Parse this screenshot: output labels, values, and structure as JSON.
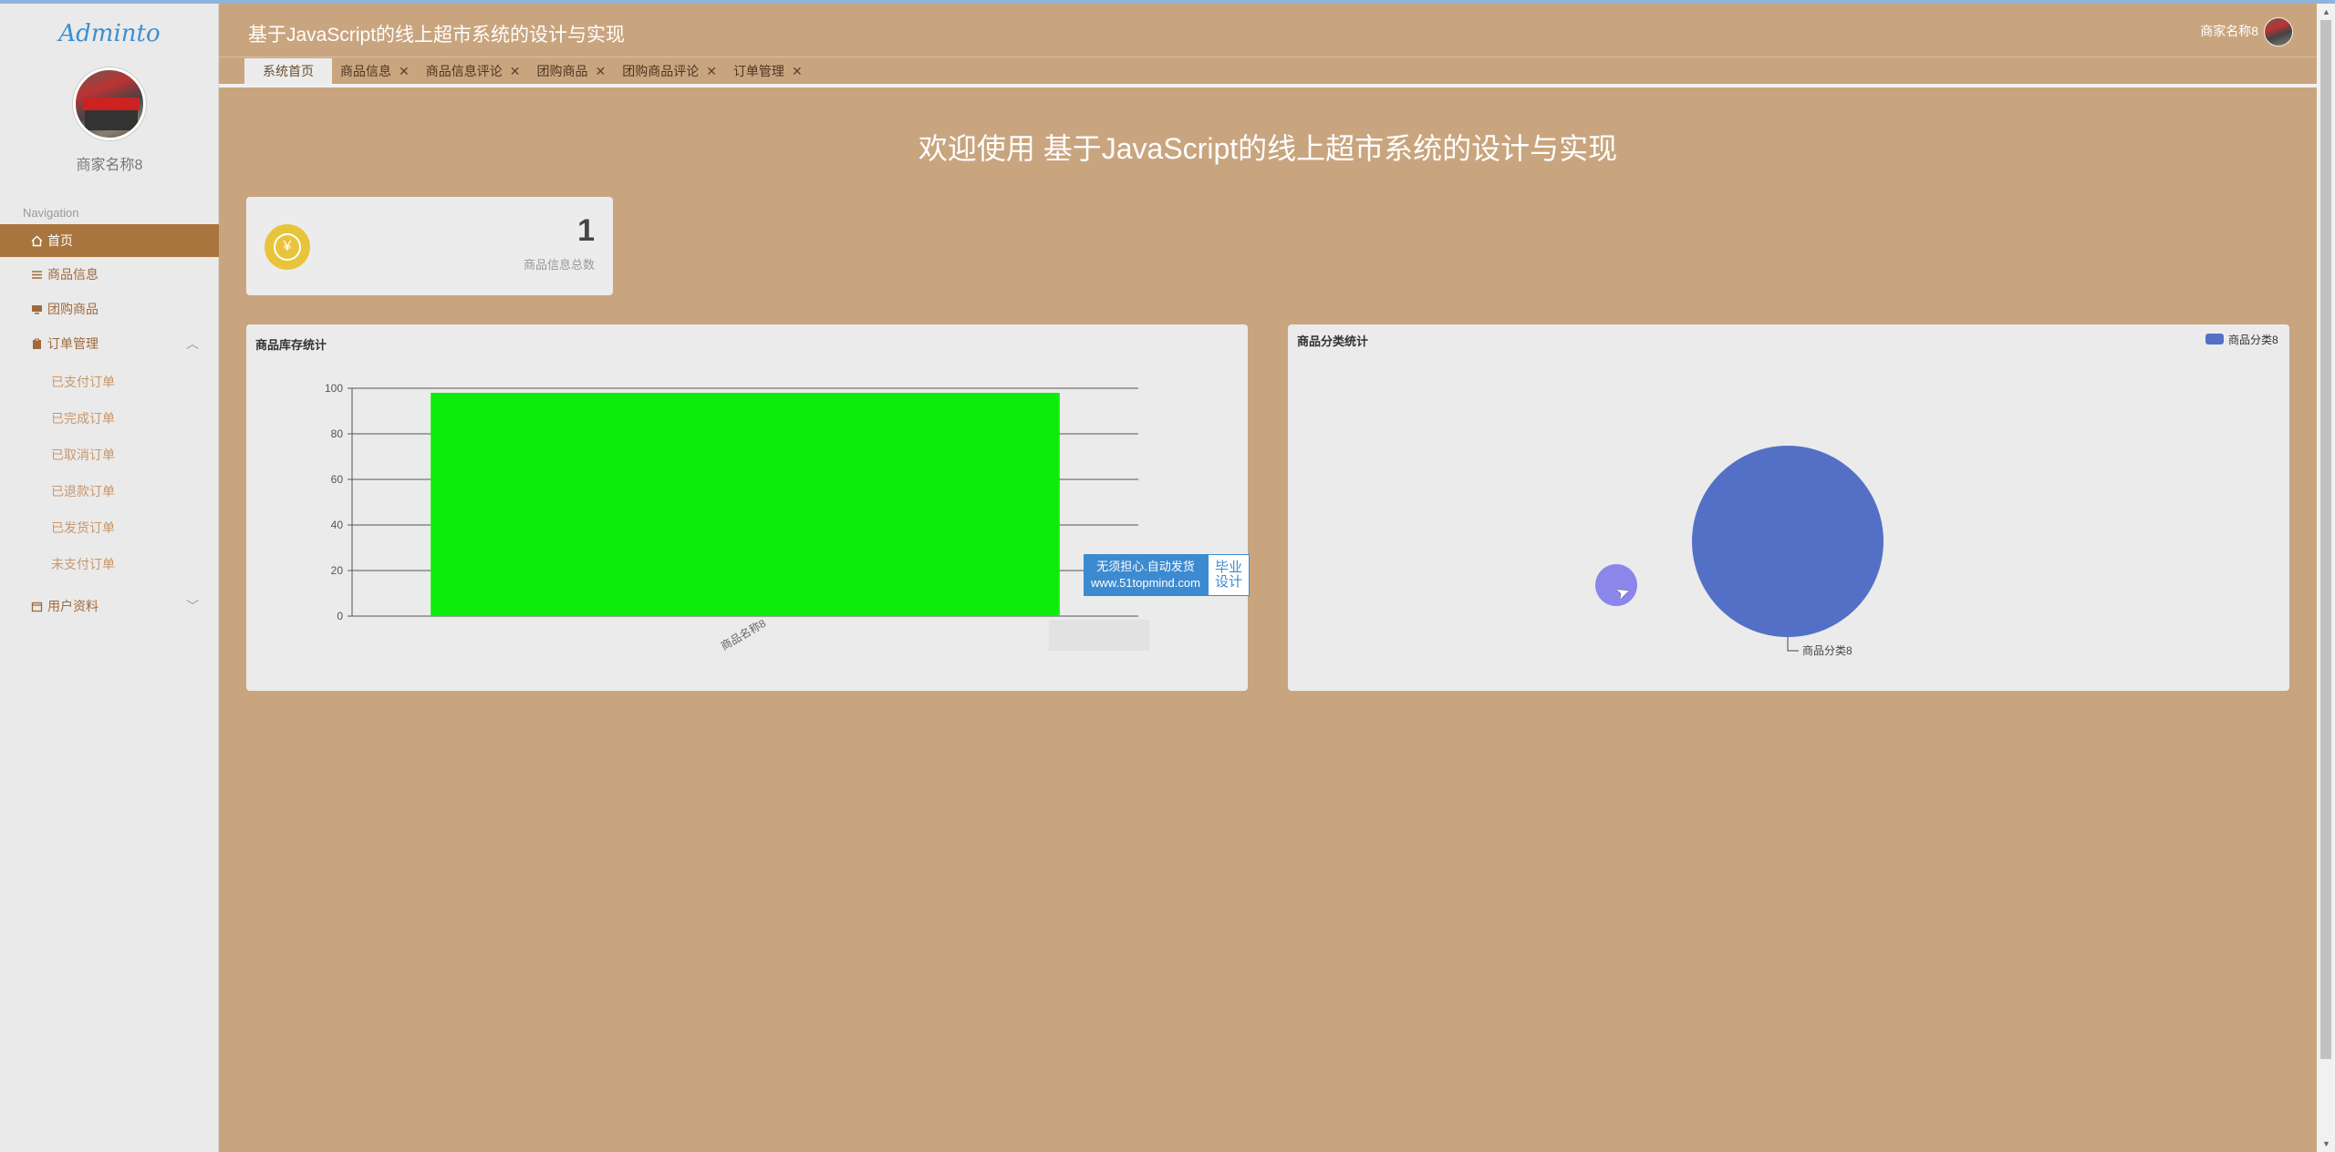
{
  "app": {
    "logo": "Adminto",
    "title": "基于JavaScript的线上超市系统的设计与实现",
    "user_name": "商家名称8"
  },
  "sidebar": {
    "user_name": "商家名称8",
    "nav_heading": "Navigation",
    "items": [
      {
        "label": "首页",
        "icon": "home-icon"
      },
      {
        "label": "商品信息",
        "icon": "list-icon"
      },
      {
        "label": "团购商品",
        "icon": "monitor-icon"
      },
      {
        "label": "订单管理",
        "icon": "clipboard-icon"
      },
      {
        "label": "用户资料",
        "icon": "calendar-icon"
      }
    ],
    "order_subitems": [
      "已支付订单",
      "已完成订单",
      "已取消订单",
      "已退款订单",
      "已发货订单",
      "未支付订单"
    ]
  },
  "tabs": [
    {
      "label": "系统首页",
      "active": true
    },
    {
      "label": "商品信息"
    },
    {
      "label": "商品信息评论"
    },
    {
      "label": "团购商品"
    },
    {
      "label": "团购商品评论"
    },
    {
      "label": "订单管理"
    }
  ],
  "welcome": "欢迎使用 基于JavaScript的线上超市系统的设计与实现",
  "stat": {
    "value": "1",
    "label": "商品信息总数",
    "icon_glyph": "¥"
  },
  "watermark": {
    "line1": "无须担心.自动发货",
    "line2": "www.51topmind.com",
    "side1": "毕业",
    "side2": "设计"
  },
  "colors": {
    "accent": "#a8753f",
    "background": "#c9a57f",
    "bar": "#0ced0c",
    "pie": "#5470c6"
  },
  "chart_data": [
    {
      "type": "bar",
      "title": "商品库存统计",
      "categories": [
        "商品名称8"
      ],
      "values": [
        98
      ],
      "ylim": [
        0,
        100
      ],
      "yticks": [
        0,
        20,
        40,
        60,
        80,
        100
      ],
      "grid": true
    },
    {
      "type": "pie",
      "title": "商品分类统计",
      "legend_position": "top-right",
      "slices": [
        {
          "label": "商品分类8",
          "value": 1
        }
      ]
    }
  ]
}
